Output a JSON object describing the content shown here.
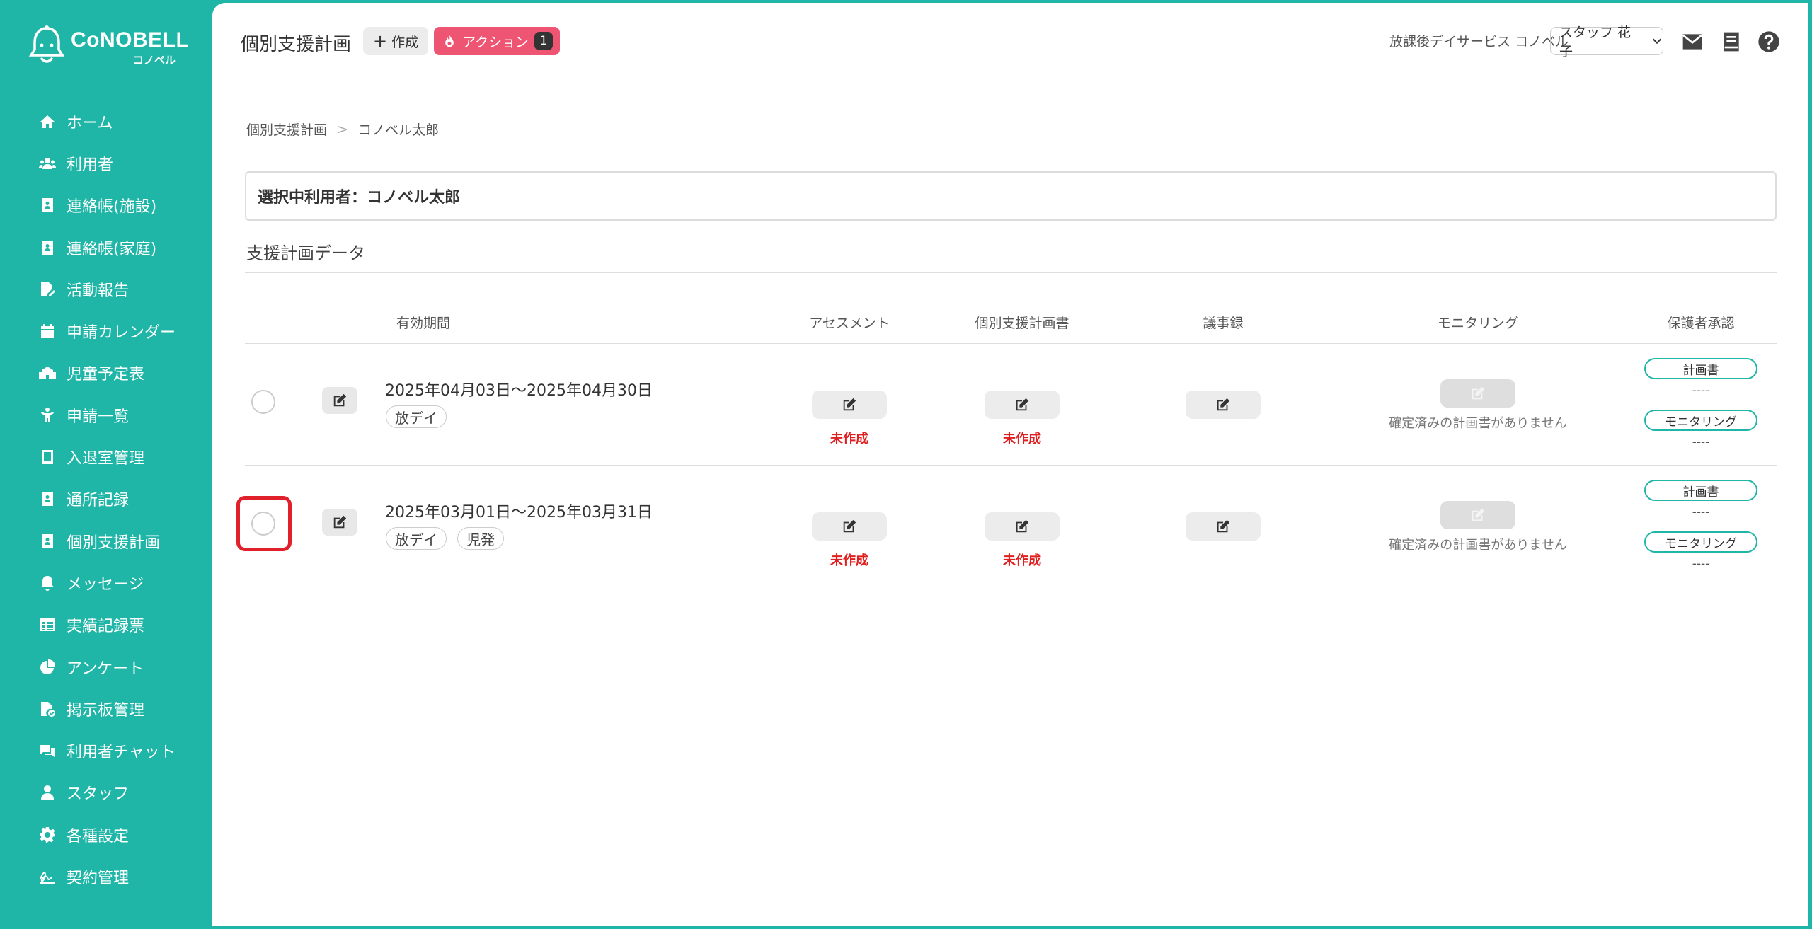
{
  "brand": {
    "name": "CoNOBELL",
    "sub": "コノベル",
    "accent": "#1fb5a7"
  },
  "sidebar": {
    "items": [
      {
        "label": "ホーム",
        "icon": "home-icon"
      },
      {
        "label": "利用者",
        "icon": "users-icon"
      },
      {
        "label": "連絡帳(施設)",
        "icon": "contact-book-icon"
      },
      {
        "label": "連絡帳(家庭)",
        "icon": "contact-book-icon"
      },
      {
        "label": "活動報告",
        "icon": "report-edit-icon"
      },
      {
        "label": "申請カレンダー",
        "icon": "calendar-icon"
      },
      {
        "label": "児童予定表",
        "icon": "school-icon"
      },
      {
        "label": "申請一覧",
        "icon": "child-icon"
      },
      {
        "label": "入退室管理",
        "icon": "tablet-icon"
      },
      {
        "label": "通所記録",
        "icon": "contact-book-icon"
      },
      {
        "label": "個別支援計画",
        "icon": "contact-book-icon"
      },
      {
        "label": "メッセージ",
        "icon": "bell-icon"
      },
      {
        "label": "実績記録票",
        "icon": "table-icon"
      },
      {
        "label": "アンケート",
        "icon": "pie-chart-icon"
      },
      {
        "label": "掲示板管理",
        "icon": "file-check-icon"
      },
      {
        "label": "利用者チャット",
        "icon": "chat-icon"
      },
      {
        "label": "スタッフ",
        "icon": "staff-icon"
      },
      {
        "label": "各種設定",
        "icon": "gear-icon"
      },
      {
        "label": "契約管理",
        "icon": "signature-icon"
      }
    ]
  },
  "header": {
    "title": "個別支援計画",
    "create_label": "作成",
    "action_label": "アクション",
    "action_count": "1",
    "facility": "放課後デイサービス コノベル",
    "staff": "スタッフ 花子"
  },
  "breadcrumb": {
    "parent": "個別支援計画",
    "current": "コノベル太郎"
  },
  "selected_user": "選択中利用者：コノベル太郎",
  "section_title": "支援計画データ",
  "table": {
    "headers": {
      "period": "有効期間",
      "assessment": "アセスメント",
      "plan": "個別支援計画書",
      "minutes": "議事録",
      "monitoring": "モニタリング",
      "approval": "保護者承認"
    },
    "rows": [
      {
        "period": "2025年04月03日～2025年04月30日",
        "tags": [
          "放デイ"
        ],
        "assessment_status": "未作成",
        "plan_status": "未作成",
        "monitoring_status": "確定済みの計画書がありません",
        "approval_plan_label": "計画書",
        "approval_plan_value": "----",
        "approval_monitoring_label": "モニタリング",
        "approval_monitoring_value": "----"
      },
      {
        "period": "2025年03月01日～2025年03月31日",
        "tags": [
          "放デイ",
          "児発"
        ],
        "assessment_status": "未作成",
        "plan_status": "未作成",
        "monitoring_status": "確定済みの計画書がありません",
        "approval_plan_label": "計画書",
        "approval_plan_value": "----",
        "approval_monitoring_label": "モニタリング",
        "approval_monitoring_value": "----"
      }
    ]
  }
}
